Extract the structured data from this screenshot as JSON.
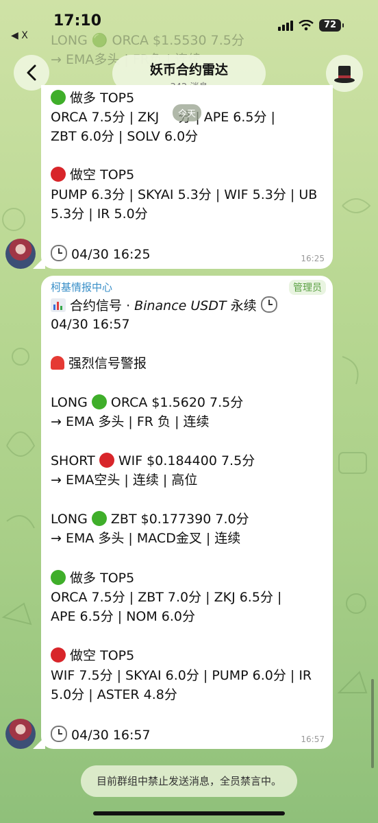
{
  "status": {
    "time": "17:10",
    "back_app": "◀ X",
    "battery": "72"
  },
  "ghost": {
    "line1": "LONG 🟢 ORCA $1.5530 7.5分",
    "line2": "→ EMA多头 | FR负 | 连续"
  },
  "header": {
    "title": "妖币合约雷达",
    "subtitle": "342 消息"
  },
  "date_badge": "今天",
  "message1": {
    "long_head": "做多 TOP5",
    "long_l1a": "ORCA 7.5分  |  ZKJ",
    "long_l1b": "分  |  APE 6.5分  |",
    "long_l2": "ZBT 6.0分  |  SOLV 6.0分",
    "short_head": "做空 TOP5",
    "short_l1": "PUMP 6.3分 | SKYAI 5.3分 | WIF 5.3分 | UB",
    "short_l2": "5.3分 | IR 5.0分",
    "stamp": "04/30 16:25",
    "time": "16:25"
  },
  "message2": {
    "sender": "柯基情报中心",
    "role": "管理员",
    "signal_a": "合约信号 · ",
    "signal_b": "Binance USDT",
    "signal_c": " 永续",
    "signal_date": "04/30 16:57",
    "alert": "强烈信号警报",
    "s1a": "LONG",
    "s1b": "ORCA  $1.5620  7.5分",
    "s1c": "→ EMA 多头 | FR 负 | 连续",
    "s2a": "SHORT",
    "s2b": "WIF  $0.184400  7.5分",
    "s2c": "→ EMA空头 | 连续 | 高位",
    "s3a": "LONG",
    "s3b": "ZBT  $0.177390  7.0分",
    "s3c": "→ EMA 多头 | MACD金叉 | 连续",
    "long_head": "做多 TOP5",
    "long_l1": "ORCA 7.5分  |  ZBT 7.0分  |  ZKJ 6.5分  |",
    "long_l2": "APE 6.5分  |  NOM 6.0分",
    "short_head": "做空 TOP5",
    "short_l1": "WIF 7.5分 | SKYAI 6.0分 | PUMP 6.0分 | IR",
    "short_l2": "5.0分 | ASTER 4.8分",
    "stamp": "04/30 16:57",
    "time": "16:57"
  },
  "footer": {
    "banned": "目前群组中禁止发送消息，全员禁言中。"
  },
  "colors": {
    "accent_green": "#3fae2a",
    "accent_red": "#d8252a",
    "sender_blue": "#3a8fc8"
  }
}
